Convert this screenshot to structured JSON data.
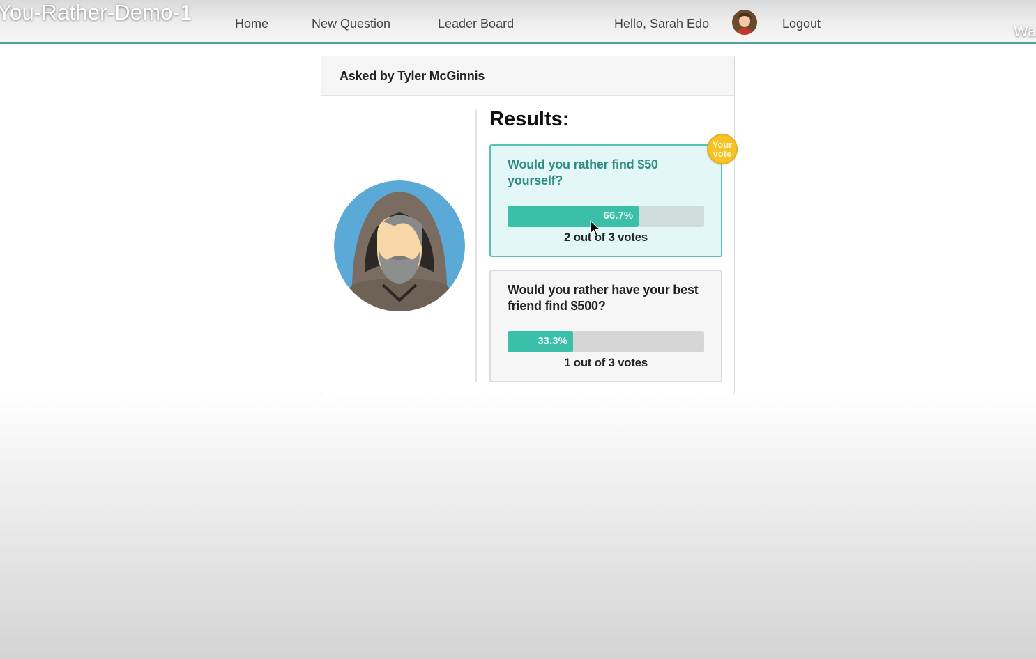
{
  "overlay": {
    "video_title": "You-Rather-Demo-1",
    "edge_text": "Wa"
  },
  "nav": {
    "home": "Home",
    "new_question": "New Question",
    "leader_board": "Leader Board",
    "greeting": "Hello, Sarah Edo",
    "logout": "Logout",
    "user_avatar_icon": "user-avatar-icon"
  },
  "question": {
    "asked_by": "Asked by Tyler McGinnis",
    "author_avatar_icon": "hooded-man-avatar-icon",
    "results_title": "Results:",
    "options": [
      {
        "text": "Would you rather find $50 yourself?",
        "percent_label": "66.7%",
        "percent": 66.7,
        "votes_text": "2 out of 3 votes",
        "selected": true,
        "badge": "Your vote"
      },
      {
        "text": "Would you rather have your best friend find $500?",
        "percent_label": "33.3%",
        "percent": 33.3,
        "votes_text": "1 out of 3 votes",
        "selected": false
      }
    ]
  },
  "colors": {
    "accent": "#3cbfa9",
    "selected_bg": "#e2f7f6",
    "selected_border": "#56c3b9",
    "badge": "#f5c228",
    "nav_underline": "#4fa59b"
  }
}
